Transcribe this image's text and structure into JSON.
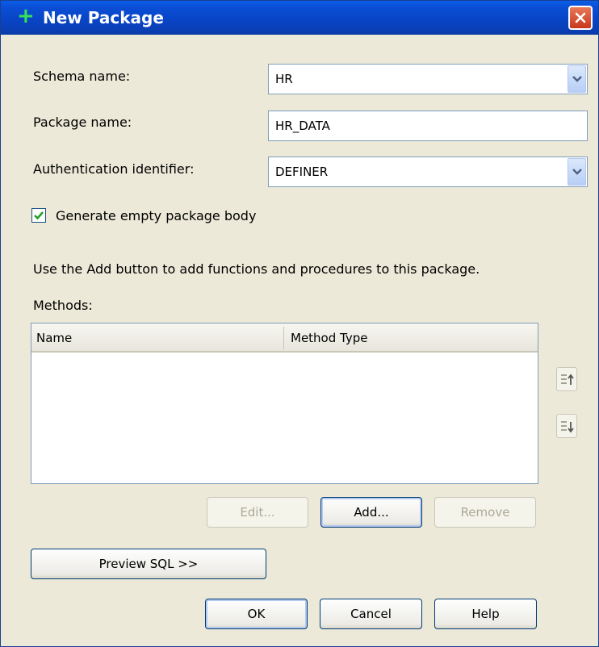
{
  "window": {
    "title": "New Package"
  },
  "form": {
    "schema_label": "Schema name:",
    "schema_value": "HR",
    "package_label": "Package name:",
    "package_value": "HR_DATA",
    "auth_label": "Authentication identifier:",
    "auth_value": "DEFINER",
    "generate_body_label": "Generate empty package body",
    "generate_body_checked": true
  },
  "instructions": "Use the Add button to add functions and procedures to this package.",
  "methods": {
    "label": "Methods:",
    "columns": [
      "Name",
      "Method Type"
    ],
    "rows": []
  },
  "buttons": {
    "edit": "Edit...",
    "add": "Add...",
    "remove": "Remove",
    "preview_sql": "Preview SQL >>",
    "ok": "OK",
    "cancel": "Cancel",
    "help": "Help"
  },
  "icons": {
    "title": "plus-icon",
    "close": "close-icon",
    "move_up": "move-up-icon",
    "move_down": "move-down-icon",
    "dropdown": "chevron-down-icon",
    "checkbox": "checkmark-icon"
  },
  "colors": {
    "titlebar": "#0a4fd6",
    "dialog_bg": "#ece9d8",
    "close_button": "#d9542f",
    "checkmark": "#21a121"
  }
}
